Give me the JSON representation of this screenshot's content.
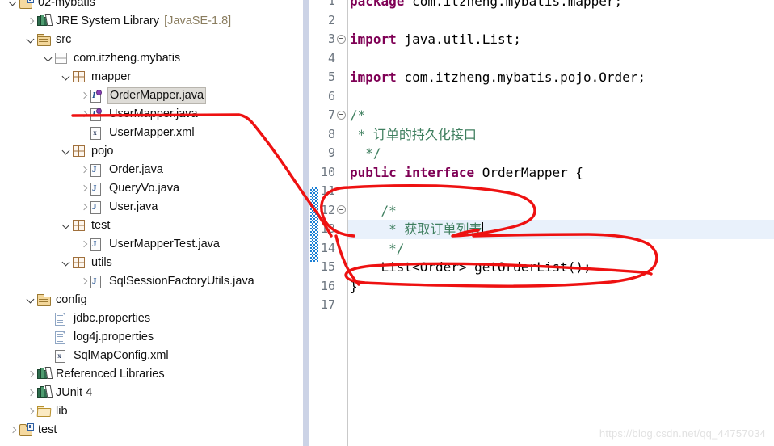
{
  "sidebar": {
    "name": "package-explorer",
    "partial_top_row": "",
    "tree": [
      {
        "indent": 0,
        "twisty": "expanded",
        "icon": "project-icon",
        "label": "02-mybatis",
        "selected": false,
        "suffix": ""
      },
      {
        "indent": 1,
        "twisty": "collapsed",
        "icon": "library-icon",
        "label": "JRE System Library",
        "selected": false,
        "suffix": "[JavaSE-1.8]"
      },
      {
        "indent": 1,
        "twisty": "expanded",
        "icon": "source-folder-icon",
        "label": "src",
        "selected": false,
        "suffix": ""
      },
      {
        "indent": 2,
        "twisty": "expanded",
        "icon": "package-empty-icon",
        "label": "com.itzheng.mybatis",
        "selected": false,
        "suffix": ""
      },
      {
        "indent": 3,
        "twisty": "expanded",
        "icon": "package-icon",
        "label": "mapper",
        "selected": false,
        "suffix": ""
      },
      {
        "indent": 4,
        "twisty": "collapsed",
        "icon": "java-interface-icon",
        "label": "OrderMapper.java",
        "selected": true,
        "suffix": ""
      },
      {
        "indent": 4,
        "twisty": "collapsed",
        "icon": "java-interface-icon",
        "label": "UserMapper.java",
        "selected": false,
        "suffix": ""
      },
      {
        "indent": 4,
        "twisty": "none",
        "icon": "xml-file-icon",
        "label": "UserMapper.xml",
        "selected": false,
        "suffix": ""
      },
      {
        "indent": 3,
        "twisty": "expanded",
        "icon": "package-icon",
        "label": "pojo",
        "selected": false,
        "suffix": ""
      },
      {
        "indent": 4,
        "twisty": "collapsed",
        "icon": "java-class-icon",
        "label": "Order.java",
        "selected": false,
        "suffix": ""
      },
      {
        "indent": 4,
        "twisty": "collapsed",
        "icon": "java-class-icon",
        "label": "QueryVo.java",
        "selected": false,
        "suffix": ""
      },
      {
        "indent": 4,
        "twisty": "collapsed",
        "icon": "java-class-icon",
        "label": "User.java",
        "selected": false,
        "suffix": ""
      },
      {
        "indent": 3,
        "twisty": "expanded",
        "icon": "package-icon",
        "label": "test",
        "selected": false,
        "suffix": ""
      },
      {
        "indent": 4,
        "twisty": "collapsed",
        "icon": "java-class-icon",
        "label": "UserMapperTest.java",
        "selected": false,
        "suffix": ""
      },
      {
        "indent": 3,
        "twisty": "expanded",
        "icon": "package-icon",
        "label": "utils",
        "selected": false,
        "suffix": ""
      },
      {
        "indent": 4,
        "twisty": "collapsed",
        "icon": "java-class-icon",
        "label": "SqlSessionFactoryUtils.java",
        "selected": false,
        "suffix": ""
      },
      {
        "indent": 1,
        "twisty": "expanded",
        "icon": "source-folder-icon",
        "label": "config",
        "selected": false,
        "suffix": ""
      },
      {
        "indent": 2,
        "twisty": "none",
        "icon": "properties-file-icon",
        "label": "jdbc.properties",
        "selected": false,
        "suffix": ""
      },
      {
        "indent": 2,
        "twisty": "none",
        "icon": "properties-file-icon",
        "label": "log4j.properties",
        "selected": false,
        "suffix": ""
      },
      {
        "indent": 2,
        "twisty": "none",
        "icon": "xml-file-icon",
        "label": "SqlMapConfig.xml",
        "selected": false,
        "suffix": ""
      },
      {
        "indent": 1,
        "twisty": "collapsed",
        "icon": "library-icon",
        "label": "Referenced Libraries",
        "selected": false,
        "suffix": ""
      },
      {
        "indent": 1,
        "twisty": "collapsed",
        "icon": "library-icon",
        "label": "JUnit 4",
        "selected": false,
        "suffix": ""
      },
      {
        "indent": 1,
        "twisty": "collapsed",
        "icon": "folder-icon",
        "label": "lib",
        "selected": false,
        "suffix": ""
      },
      {
        "indent": 0,
        "twisty": "collapsed",
        "icon": "project-icon",
        "label": "test",
        "selected": false,
        "suffix": ""
      }
    ]
  },
  "editor": {
    "name": "java-editor",
    "file": "OrderMapper.java",
    "highlighted_line": 13,
    "caret_line": 13,
    "change_bar_lines": [
      12,
      13,
      14,
      15
    ],
    "lines": [
      {
        "num": 1,
        "fold": false,
        "tokens": [
          {
            "t": "kw",
            "v": "package"
          },
          {
            "t": "plain",
            "v": " com.itzheng.mybatis.mapper;"
          }
        ]
      },
      {
        "num": 2,
        "fold": false,
        "tokens": []
      },
      {
        "num": 3,
        "fold": true,
        "tokens": [
          {
            "t": "kw",
            "v": "import"
          },
          {
            "t": "plain",
            "v": " java.util.List;"
          }
        ]
      },
      {
        "num": 4,
        "fold": false,
        "tokens": []
      },
      {
        "num": 5,
        "fold": false,
        "tokens": [
          {
            "t": "kw",
            "v": "import"
          },
          {
            "t": "plain",
            "v": " com.itzheng.mybatis.pojo.Order;"
          }
        ]
      },
      {
        "num": 6,
        "fold": false,
        "tokens": []
      },
      {
        "num": 7,
        "fold": true,
        "tokens": [
          {
            "t": "cmt",
            "v": "/*"
          }
        ]
      },
      {
        "num": 8,
        "fold": false,
        "tokens": [
          {
            "t": "cmt",
            "v": " * 订单的持久化接口"
          }
        ]
      },
      {
        "num": 9,
        "fold": false,
        "tokens": [
          {
            "t": "cmt",
            "v": "  */"
          }
        ]
      },
      {
        "num": 10,
        "fold": false,
        "tokens": [
          {
            "t": "kw",
            "v": "public interface"
          },
          {
            "t": "plain",
            "v": " OrderMapper {"
          }
        ]
      },
      {
        "num": 11,
        "fold": false,
        "tokens": []
      },
      {
        "num": 12,
        "fold": true,
        "tokens": [
          {
            "t": "cmt",
            "v": "    /*"
          }
        ]
      },
      {
        "num": 13,
        "fold": false,
        "tokens": [
          {
            "t": "cmt",
            "v": "     * 获取订单列表"
          }
        ]
      },
      {
        "num": 14,
        "fold": false,
        "tokens": [
          {
            "t": "cmt",
            "v": "     */"
          }
        ]
      },
      {
        "num": 15,
        "fold": false,
        "tokens": [
          {
            "t": "plain",
            "v": "    List<Order> getOrderList();"
          }
        ]
      },
      {
        "num": 16,
        "fold": false,
        "tokens": [
          {
            "t": "plain",
            "v": "}"
          }
        ]
      },
      {
        "num": 17,
        "fold": false,
        "tokens": []
      }
    ]
  },
  "annotations": {
    "name": "red-ink-annotations",
    "color": "#ee1111",
    "shapes": [
      {
        "kind": "underline-and-arrow",
        "target": "OrderMapper.java tree item"
      },
      {
        "kind": "loop",
        "target": "javadoc comment block lines 12-14"
      },
      {
        "kind": "loop",
        "target": "getOrderList method declaration line 15"
      }
    ]
  },
  "watermark": {
    "text": "https://blog.csdn.net/qq_44757034"
  }
}
